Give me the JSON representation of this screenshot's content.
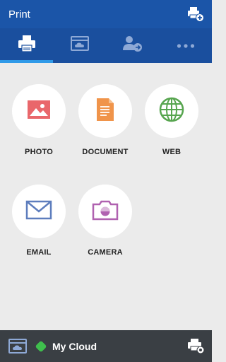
{
  "appbar": {
    "title": "Print",
    "action_icon": "add-printer-icon"
  },
  "tabs": [
    {
      "icon": "printer-icon",
      "active": true
    },
    {
      "icon": "cloud-storage-icon",
      "active": false
    },
    {
      "icon": "user-share-icon",
      "active": false
    },
    {
      "icon": "more-icon",
      "active": false
    }
  ],
  "print_options": [
    {
      "label": "PHOTO",
      "icon": "photo-icon",
      "color": "#e9676b"
    },
    {
      "label": "DOCUMENT",
      "icon": "document-icon",
      "color": "#f0944a"
    },
    {
      "label": "WEB",
      "icon": "globe-icon",
      "color": "#57a54f"
    },
    {
      "label": "EMAIL",
      "icon": "envelope-icon",
      "color": "#5d7dbd"
    },
    {
      "label": "CAMERA",
      "icon": "camera-icon",
      "color": "#b062b0"
    }
  ],
  "bottombar": {
    "cloud_label": "My Cloud",
    "status_color": "#3fbf4d",
    "settings_icon": "printer-settings-icon"
  },
  "colors": {
    "appbar": "#1b55a8",
    "tab_indicator": "#2f9ae8",
    "background": "#ebebeb",
    "bottombar": "#3a3f44"
  }
}
